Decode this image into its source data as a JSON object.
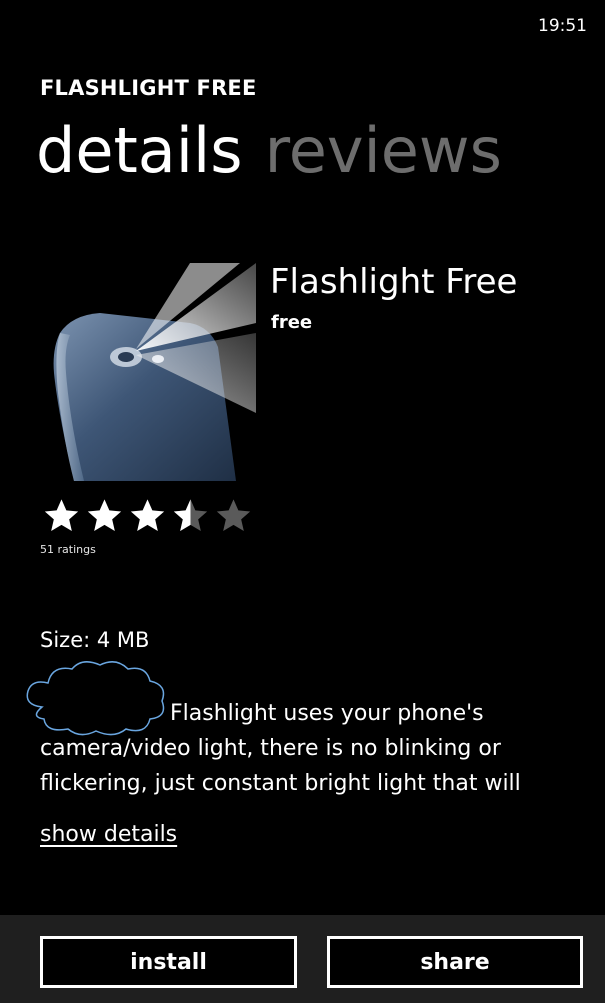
{
  "status_bar": {
    "time": "19:51"
  },
  "header": {
    "app_title": "FLASHLIGHT FREE"
  },
  "pivot": {
    "tabs": [
      {
        "label": "details",
        "active": true
      },
      {
        "label": "reviews",
        "active": false
      }
    ]
  },
  "app": {
    "name": "Flashlight Free",
    "price": "free",
    "rating": 3.5,
    "rating_max": 5,
    "ratings_count": "51 ratings",
    "size": "Size: 4 MB",
    "description_lines": [
      "Flashlight uses your phone's",
      "camera/video light, there is no blinking or",
      "flickering, just constant bright light that will"
    ],
    "show_details_label": "show details"
  },
  "app_bar": {
    "install_label": "install",
    "share_label": "share"
  },
  "colors": {
    "background": "#000000",
    "foreground": "#ffffff",
    "inactive_tab": "#6d6d6d",
    "redaction_outline": "#6aa6e0"
  },
  "icons": {
    "star_full": "star-icon",
    "star_half": "star-half-icon",
    "star_empty": "star-empty-icon"
  }
}
